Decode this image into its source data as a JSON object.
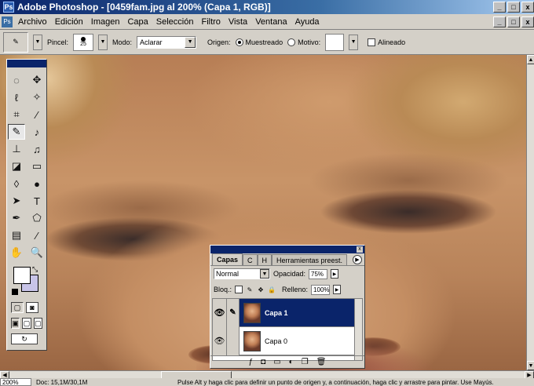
{
  "window": {
    "title": "Adobe Photoshop - [0459fam.jpg al 200% (Capa 1, RGB)]",
    "app_icon": "photoshop-icon",
    "controls": [
      "_",
      "□",
      "x"
    ]
  },
  "menu": {
    "items": [
      "Archivo",
      "Edición",
      "Imagen",
      "Capa",
      "Selección",
      "Filtro",
      "Vista",
      "Ventana",
      "Ayuda"
    ]
  },
  "options_bar": {
    "brush_label": "Pincel:",
    "brush_size": "25",
    "mode_label": "Modo:",
    "mode_value": "Aclarar",
    "source_label": "Origen:",
    "source_sampled": "Muestreado",
    "source_pattern": "Motivo:",
    "aligned_label": "Alineado",
    "source_selected": "Muestreado"
  },
  "toolbox": {
    "tools": [
      "marquee-icon",
      "move-icon",
      "lasso-icon",
      "magic-wand-icon",
      "crop-icon",
      "slice-icon",
      "healing-brush-icon",
      "brush-icon",
      "clone-stamp-icon",
      "history-brush-icon",
      "eraser-icon",
      "gradient-icon",
      "blur-icon",
      "dodge-icon",
      "path-select-icon",
      "type-icon",
      "pen-icon",
      "shape-icon",
      "notes-icon",
      "eyedropper-icon",
      "hand-icon",
      "zoom-icon"
    ],
    "selected_tool": "healing-brush-icon",
    "foreground_color": "#ffffff",
    "background_color": "#c8c4e8"
  },
  "layers_panel": {
    "tabs": [
      "Capas",
      "C",
      "H",
      "Herramientas preest."
    ],
    "blend_mode": "Normal",
    "opacity_label": "Opacidad:",
    "opacity_value": "75%",
    "lock_label": "Bloq.:",
    "fill_label": "Relleno:",
    "fill_value": "100%",
    "layers": [
      {
        "name": "Capa 1",
        "selected": true,
        "visible": true,
        "linked": true
      },
      {
        "name": "Capa 0",
        "selected": false,
        "visible": true,
        "linked": false
      }
    ],
    "bottom_icons": [
      "layer-style-icon",
      "mask-icon",
      "new-set-icon",
      "adjustment-icon",
      "new-layer-icon",
      "trash-icon"
    ]
  },
  "status_bar": {
    "zoom": "200%",
    "doc_info": "Doc: 15,1M/30,1M",
    "tip": "Pulse Alt y haga clic para definir un punto de origen y, a continuación, haga clic y arrastre para pintar. Use Mayús."
  }
}
